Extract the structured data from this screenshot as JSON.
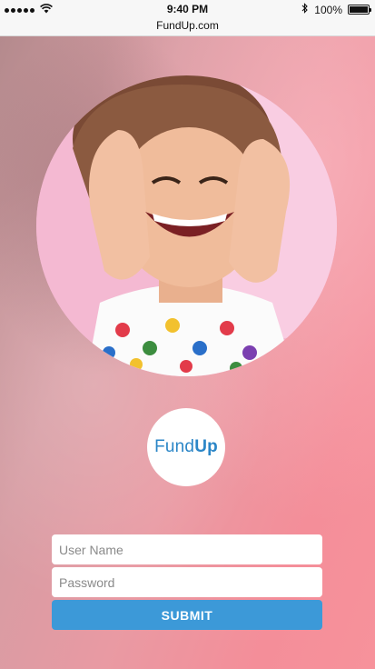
{
  "status_bar": {
    "time": "9:40 PM",
    "battery_text": "100%",
    "battery_level": 1.0,
    "signal_bars": 5
  },
  "browser": {
    "url": "FundUp.com"
  },
  "logo": {
    "part1": "Fund",
    "part2": "Up",
    "color": "#2b86c7"
  },
  "form": {
    "username_placeholder": "User Name",
    "password_placeholder": "Password",
    "submit_label": "SUBMIT",
    "submit_color": "#3c99d8"
  },
  "icons": [
    "wifi-icon",
    "bluetooth-icon",
    "battery-icon",
    "signal-icon"
  ]
}
